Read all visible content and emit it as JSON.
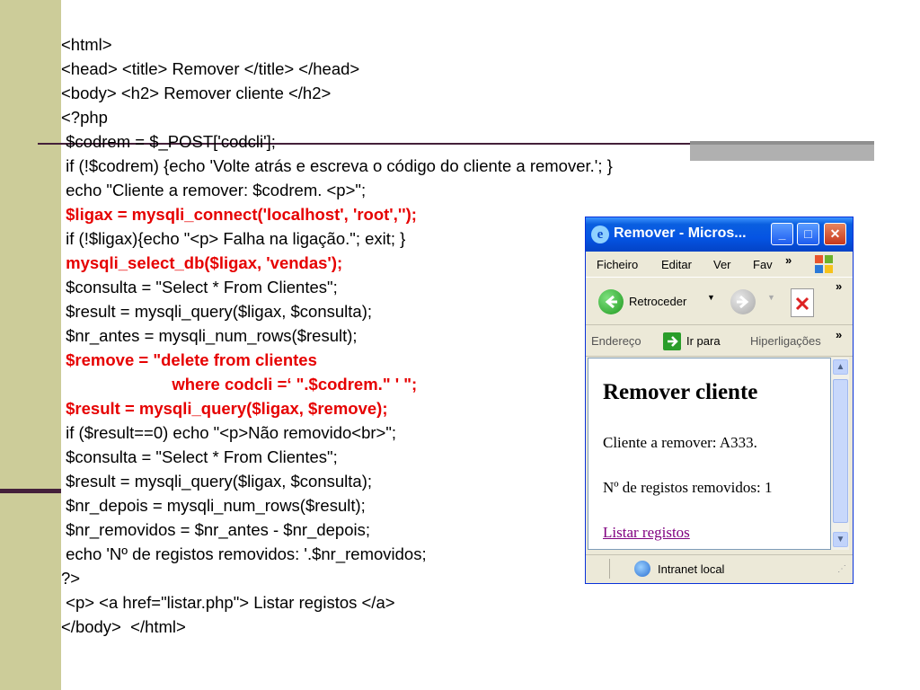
{
  "code_lines": [
    {
      "text": "<html>",
      "red": false
    },
    {
      "text": "<head> <title> Remover </title> </head>",
      "red": false
    },
    {
      "text": "<body> <h2> Remover cliente </h2>",
      "red": false
    },
    {
      "text": "<?php",
      "red": false
    },
    {
      "text": " $codrem = $_POST['codcli'];",
      "red": false
    },
    {
      "text": " if (!$codrem) {echo 'Volte atrás e escreva o código do cliente a remover.'; }",
      "red": false
    },
    {
      "text": " echo \"Cliente a remover: $codrem. <p>\";",
      "red": false
    },
    {
      "text": " $ligax = mysqli_connect('localhost', 'root','');",
      "red": true
    },
    {
      "text": " if (!$ligax){echo \"<p> Falha na ligação.\"; exit; }",
      "red": false
    },
    {
      "text": " mysqli_select_db($ligax, 'vendas');",
      "red": true
    },
    {
      "text": " $consulta = \"Select * From Clientes\";",
      "red": false
    },
    {
      "text": " $result = mysqli_query($ligax, $consulta);",
      "red": false
    },
    {
      "text": " $nr_antes = mysqli_num_rows($result);",
      "red": false
    },
    {
      "text": " $remove = \"delete from clientes",
      "red": true
    },
    {
      "text": "                        where codcli =‘ \".$codrem.\" ' \";",
      "red": true
    },
    {
      "text": " $result = mysqli_query($ligax, $remove);",
      "red": true
    },
    {
      "text": " if ($result==0) echo \"<p>Não removido<br>\";",
      "red": false
    },
    {
      "text": " $consulta = \"Select * From Clientes\";",
      "red": false
    },
    {
      "text": " $result = mysqli_query($ligax, $consulta);",
      "red": false
    },
    {
      "text": " $nr_depois = mysqli_num_rows($result);",
      "red": false
    },
    {
      "text": " $nr_removidos = $nr_antes - $nr_depois;",
      "red": false
    },
    {
      "text": " echo 'Nº de registos removidos: '.$nr_removidos;",
      "red": false
    },
    {
      "text": "?>",
      "red": false
    },
    {
      "text": " <p> <a href=\"listar.php\"> Listar registos </a>",
      "red": false
    },
    {
      "text": "</body>  </html>",
      "red": false
    }
  ],
  "browser": {
    "title": "Remover - Micros...",
    "menu": {
      "file": "Ficheiro",
      "edit": "Editar",
      "view": "Ver",
      "fav": "Fav",
      "more": "»"
    },
    "toolbar": {
      "back": "Retroceder",
      "more": "»"
    },
    "address": {
      "label": "Endereço",
      "go": "Ir para",
      "links": "Hiperligações",
      "more": "»"
    },
    "page": {
      "heading": "Remover cliente",
      "client_line": "Cliente a remover: A333.",
      "removed_line": "Nº de registos removidos: 1",
      "link": "Listar registos"
    },
    "status": {
      "zone": "Intranet local"
    }
  },
  "colors": {
    "sidebar": "#cccc99",
    "accent_line": "#44203a",
    "highlight_red": "#e60000",
    "link": "#800080"
  }
}
